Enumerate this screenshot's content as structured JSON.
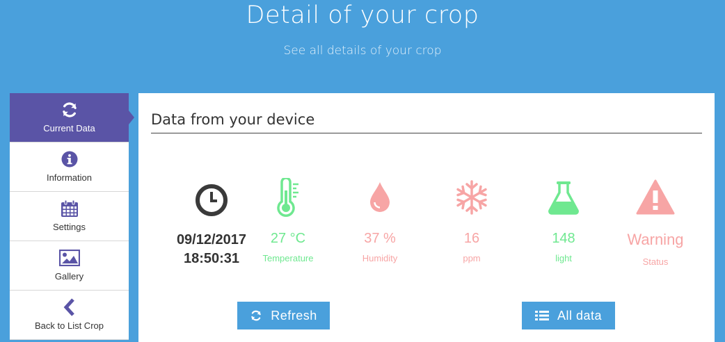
{
  "header": {
    "title": "Detail of your crop",
    "subtitle": "See all details of your crop"
  },
  "sidebar": {
    "items": [
      {
        "label": "Current Data",
        "icon": "refresh-icon"
      },
      {
        "label": "Information",
        "icon": "info-icon"
      },
      {
        "label": "Settings",
        "icon": "calendar-icon"
      },
      {
        "label": "Gallery",
        "icon": "image-icon"
      },
      {
        "label": "Back to List Crop",
        "icon": "chevron-left-icon"
      }
    ],
    "active_color": "#5a54a6"
  },
  "panel": {
    "title": "Data from your device",
    "datetime": {
      "date": "09/12/2017",
      "time": "18:50:31",
      "icon": "clock-icon"
    },
    "metrics": [
      {
        "value": "27 °C",
        "label": "Temperature",
        "icon": "thermometer-icon",
        "color": "#6fe890"
      },
      {
        "value": "37 %",
        "label": "Humidity",
        "icon": "droplet-icon",
        "color": "#f7a5a5"
      },
      {
        "value": "16",
        "label": "ppm",
        "icon": "snowflake-icon",
        "color": "#f7a5a5"
      },
      {
        "value": "148",
        "label": "light",
        "icon": "flask-icon",
        "color": "#6fe890"
      },
      {
        "value": "Warning",
        "label": "Status",
        "icon": "warning-icon",
        "color": "#f7a5a5"
      }
    ],
    "buttons": {
      "refresh": {
        "label": "Refresh",
        "icon": "refresh-icon"
      },
      "all_data": {
        "label": "All data",
        "icon": "list-icon"
      }
    }
  },
  "colors": {
    "background": "#4aa0dc",
    "accent": "#5a54a6",
    "green": "#6fe890",
    "pink": "#f7a5a5"
  }
}
